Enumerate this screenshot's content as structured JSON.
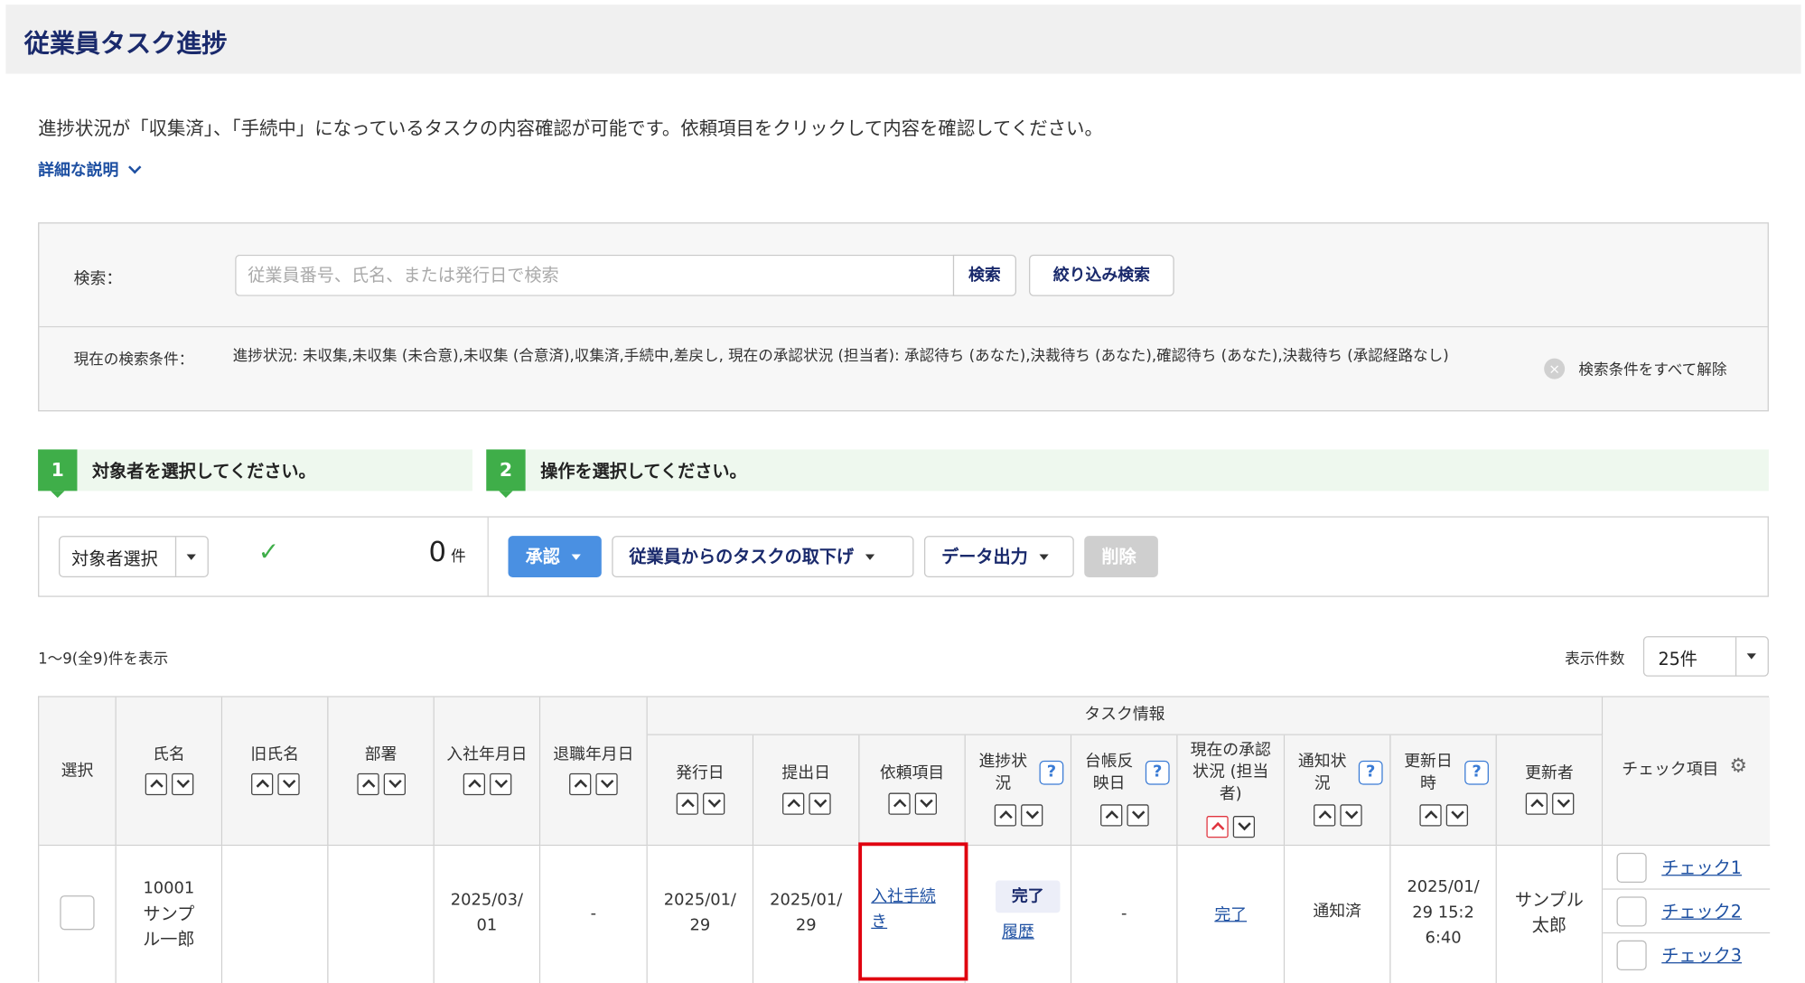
{
  "header": {
    "title": "従業員タスク進捗"
  },
  "description": "進捗状況が「収集済」、「手続中」になっているタスクの内容確認が可能です。依頼項目をクリックして内容を確認してください。",
  "detail_link": "詳細な説明",
  "search": {
    "label": "検索：",
    "placeholder": "従業員番号、氏名、または発行日で検索",
    "value": "",
    "search_button": "検索",
    "filter_button": "絞り込み検索",
    "conditions_label": "現在の検索条件：",
    "conditions_text": "進捗状況: 未収集,未収集 (未合意),未収集 (合意済),収集済,手続中,差戻し, 現在の承認状況 (担当者): 承認待ち (あなた),決裁待ち (あなた),確認待ち (あなた),決裁待ち (承認経路なし)",
    "clear_all": "検索条件をすべて解除",
    "clear_icon": "×"
  },
  "steps": [
    {
      "num": "1",
      "text": "対象者を選択してください。"
    },
    {
      "num": "2",
      "text": "操作を選択してください。"
    }
  ],
  "actions": {
    "target_select": "対象者選択",
    "check_icon": "✓",
    "count": "0",
    "count_unit": "件",
    "approve": "承認",
    "withdraw": "従業員からのタスクの取下げ",
    "export": "データ出力",
    "delete": "削除"
  },
  "list": {
    "range": "1〜9(全9)件を表示",
    "per_page_label": "表示件数",
    "per_page_value": "25件"
  },
  "columns": {
    "select": "選択",
    "name": "氏名",
    "old_name": "旧氏名",
    "dept": "部署",
    "join_date": "入社年月日",
    "leave_date": "退職年月日",
    "task_info": "タスク情報",
    "issue_date": "発行日",
    "submit_date": "提出日",
    "request_item": "依頼項目",
    "progress": "進捗状況",
    "ledger": "台帳反映日",
    "approval": "現在の承認状況 (担当者)",
    "notify": "通知状況",
    "updated_at": "更新日時",
    "updater": "更新者",
    "check_items": "チェック項目",
    "help": "?"
  },
  "rows": [
    {
      "employee_no": "10001",
      "name": "サンプル一郎",
      "old_name": "",
      "dept": "",
      "join_date": "2025/03/01",
      "leave_date": "-",
      "issue_date": "2025/01/29",
      "submit_date": "2025/01/29",
      "request_item": "入社手続き",
      "progress": "完了",
      "history": "履歴",
      "ledger": "-",
      "approval": "完了",
      "notify": "通知済",
      "updated_at": "2025/01/29 15:26:40",
      "updater": "サンプル太郎",
      "checks": [
        "チェック1",
        "チェック2",
        "チェック3"
      ]
    }
  ]
}
